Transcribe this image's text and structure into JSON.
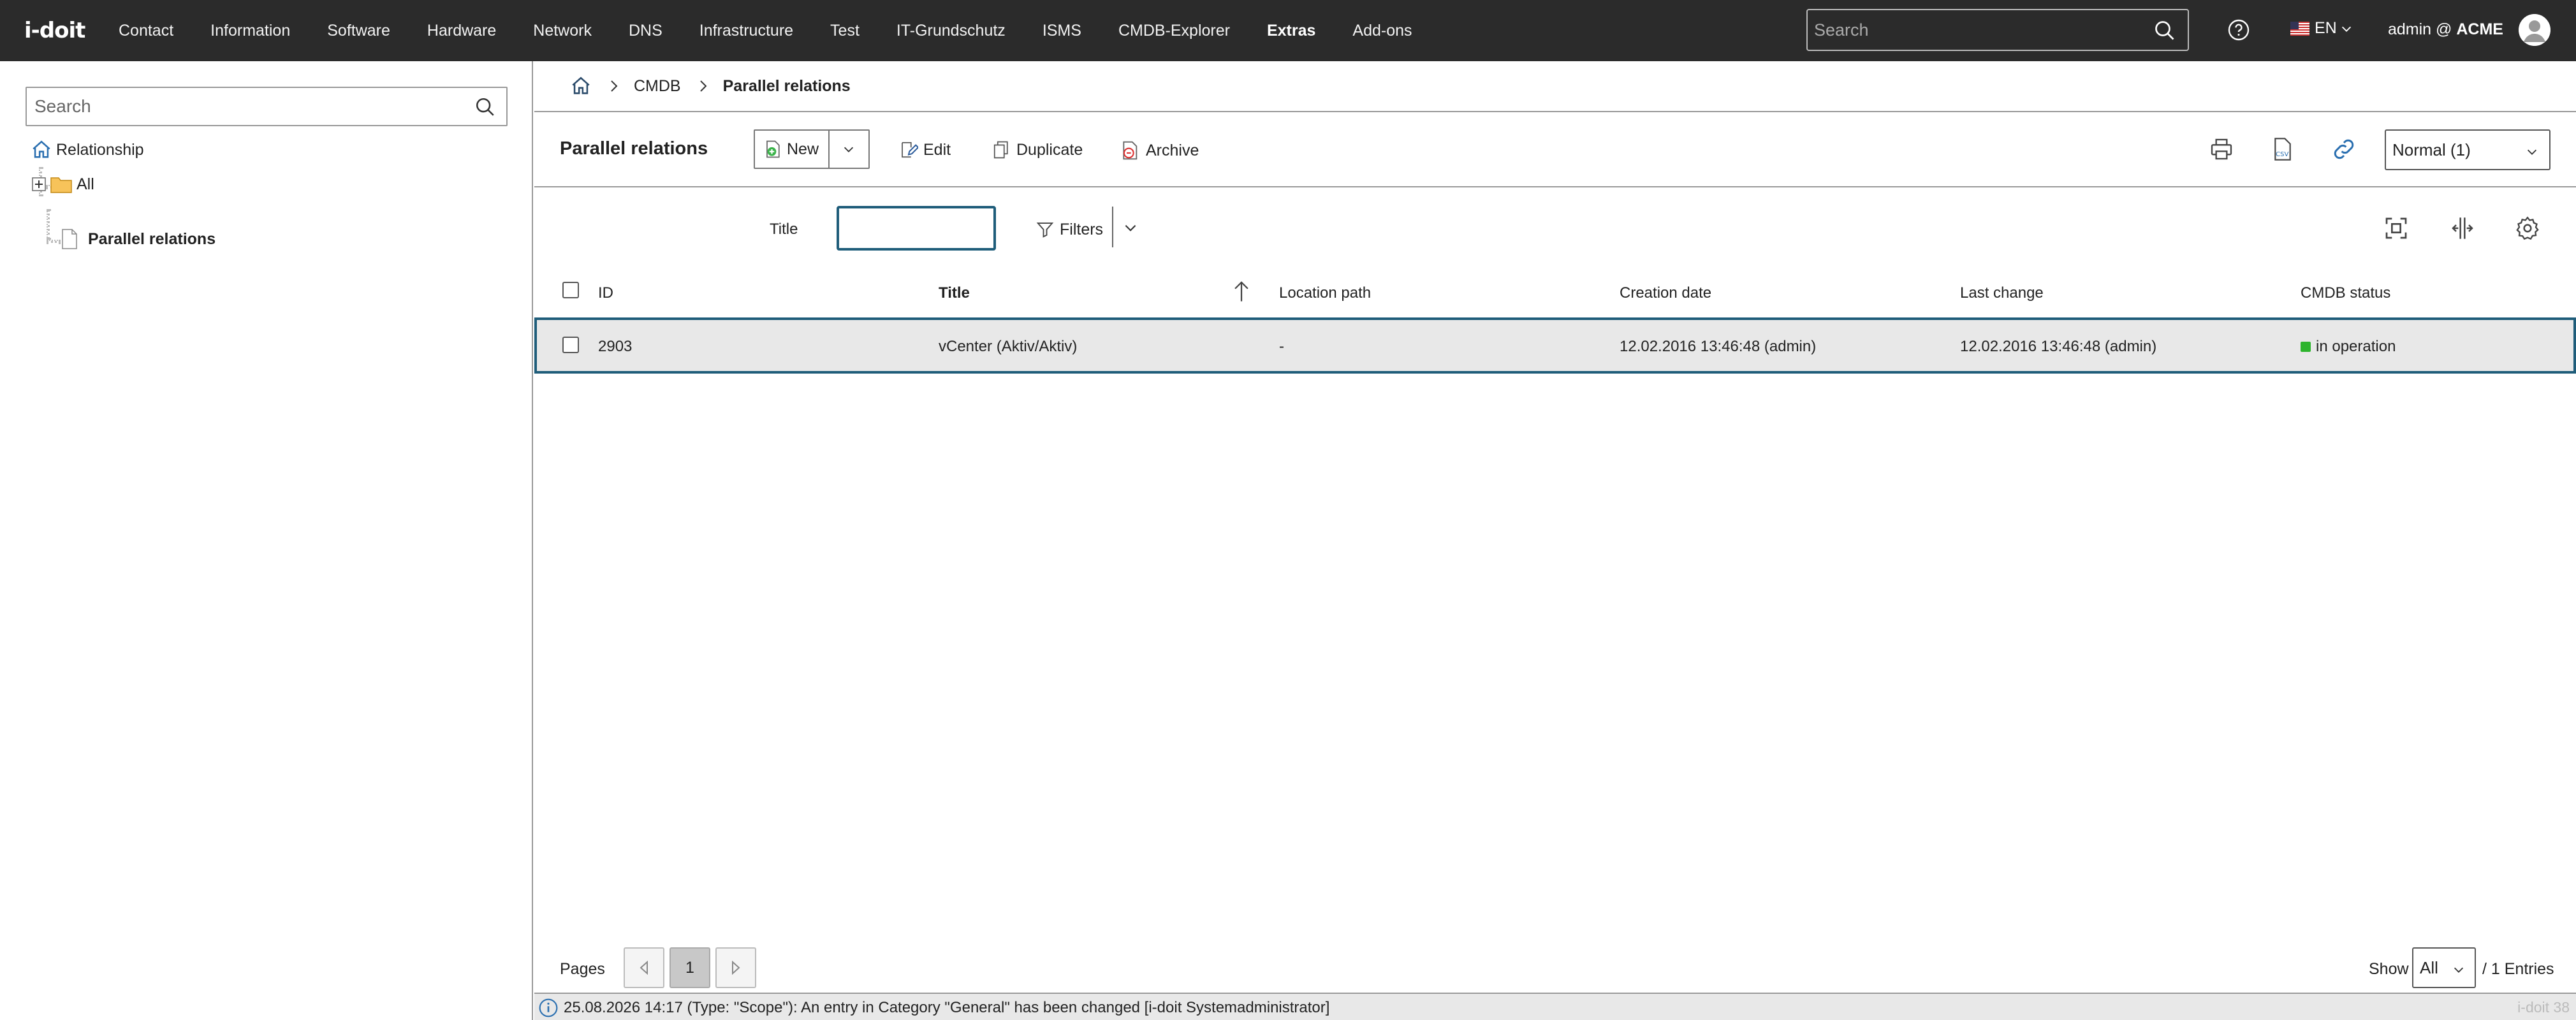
{
  "logo": "i-doit",
  "nav": {
    "items": [
      "Contact",
      "Information",
      "Software",
      "Hardware",
      "Network",
      "DNS",
      "Infrastructure",
      "Test",
      "IT-Grundschutz",
      "ISMS",
      "CMDB-Explorer",
      "Extras",
      "Add-ons"
    ],
    "active": "Extras"
  },
  "top_search": {
    "placeholder": "Search"
  },
  "language": "EN",
  "user": {
    "name": "admin @",
    "tenant": "ACME"
  },
  "sidebar": {
    "search_placeholder": "Search",
    "tree": {
      "root": "Relationship",
      "folder": "All",
      "leaf": "Parallel relations"
    }
  },
  "breadcrumb": {
    "cmdb": "CMDB",
    "current": "Parallel relations"
  },
  "toolbar": {
    "title": "Parallel relations",
    "new_label": "New",
    "edit_label": "Edit",
    "duplicate_label": "Duplicate",
    "archive_label": "Archive",
    "view_mode": "Normal (1)"
  },
  "filter": {
    "title_label": "Title",
    "title_value": "",
    "filters_label": "Filters"
  },
  "table": {
    "columns": {
      "id": "ID",
      "title": "Title",
      "location": "Location path",
      "created": "Creation date",
      "changed": "Last change",
      "status": "CMDB status"
    },
    "rows": [
      {
        "id": "2903",
        "title": "vCenter (Aktiv/Aktiv)",
        "location": "-",
        "created": "12.02.2016 13:46:48 (admin)",
        "changed": "12.02.2016 13:46:48 (admin)",
        "status": "in operation",
        "status_color": "#2db42d"
      }
    ]
  },
  "pager": {
    "pages_label": "Pages",
    "current_page": "1",
    "show_label": "Show",
    "show_value": "All",
    "entries_label": "/ 1 Entries"
  },
  "statusbar": {
    "message": "25.08.2026 14:17 (Type: \"Scope\"): An entry in Category \"General\" has been changed [i-doit Systemadministrator]",
    "version": "i-doit 38"
  },
  "colors": {
    "topbar": "#2b2b2b",
    "accent": "#1f5d7a",
    "status_green": "#2db42d"
  }
}
